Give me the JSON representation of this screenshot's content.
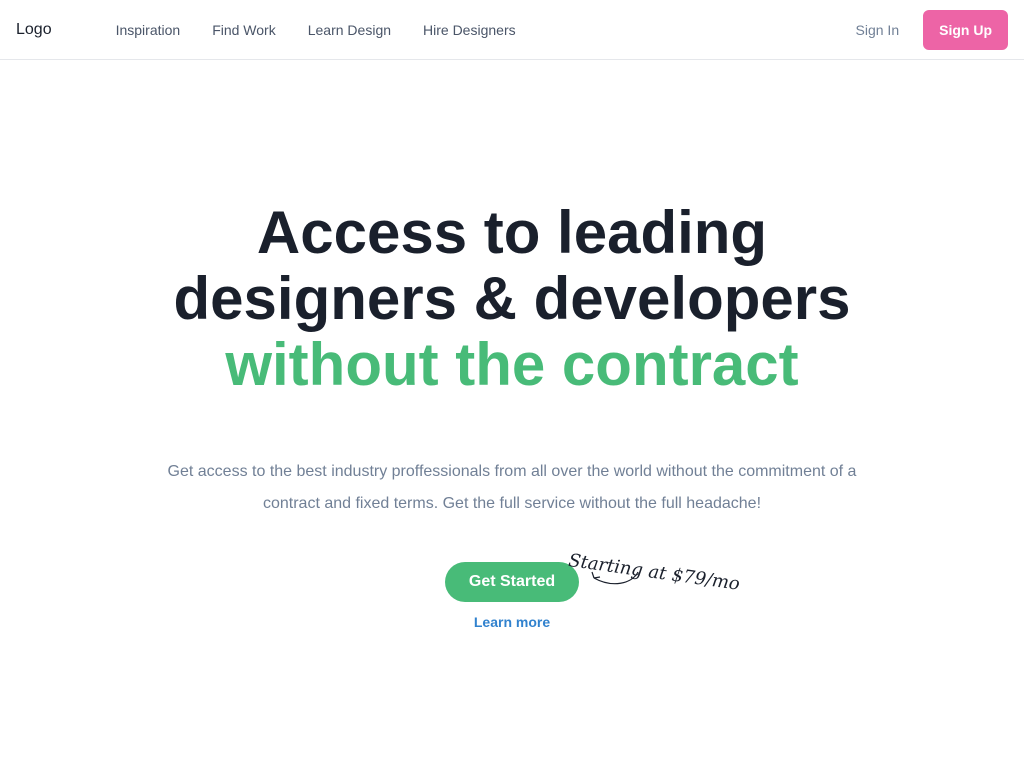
{
  "nav": {
    "logo": "Logo",
    "links": [
      {
        "label": "Inspiration"
      },
      {
        "label": "Find Work"
      },
      {
        "label": "Learn Design"
      },
      {
        "label": "Hire Designers"
      }
    ],
    "sign_in": "Sign In",
    "sign_up": "Sign Up"
  },
  "hero": {
    "line1": "Access to leading",
    "line2": "designers & developers",
    "line3": "without the contract",
    "subtext": "Get access to the best industry proffessionals from all over the world without the commitment of a contract and fixed terms. Get the full service without the full headache!",
    "cta_primary": "Get Started",
    "cta_secondary": "Learn more",
    "price_note": "Starting at $79/mo"
  },
  "colors": {
    "accent_green": "#48bb78",
    "signup_pink": "#ed64a6",
    "link_blue": "#3182ce",
    "heading_dark": "#1a202c",
    "muted_text": "#718096"
  }
}
